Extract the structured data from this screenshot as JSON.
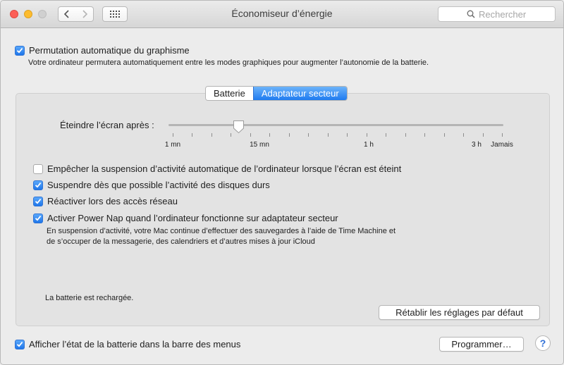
{
  "window": {
    "title": "Économiseur d’énergie",
    "search_placeholder": "Rechercher"
  },
  "graphics_switching": {
    "checked": true,
    "label": "Permutation automatique du graphisme",
    "description": "Votre ordinateur permutera automatiquement entre les modes graphiques pour augmenter l’autonomie de la batterie."
  },
  "tabs": [
    {
      "label": "Batterie",
      "selected": false
    },
    {
      "label": "Adaptateur secteur",
      "selected": true
    }
  ],
  "display_sleep": {
    "label": "Éteindre l’écran après :",
    "selected_value": "10 mn",
    "tick_labels": [
      "1 mn",
      "15 mn",
      "1 h",
      "3 h",
      "Jamais"
    ]
  },
  "options": [
    {
      "checked": false,
      "label": "Empêcher la suspension d’activité automatique de l’ordinateur lorsque l’écran est éteint"
    },
    {
      "checked": true,
      "label": "Suspendre dès que possible l’activité des disques durs"
    },
    {
      "checked": true,
      "label": "Réactiver lors des accès réseau"
    },
    {
      "checked": true,
      "label": "Activer Power Nap quand l’ordinateur fonctionne sur adaptateur secteur"
    }
  ],
  "power_nap_note": {
    "line1": "En suspension d’activité, votre Mac continue d’effectuer des sauvegardes à l’aide de Time Machine et",
    "line2": "de s’occuper de la messagerie, des calendriers et d’autres mises à jour iCloud"
  },
  "battery_status": "La batterie est rechargée.",
  "restore_defaults_label": "Rétablir les réglages par défaut",
  "show_battery_status": {
    "checked": true,
    "label": "Afficher l’état de la batterie dans la barre des menus"
  },
  "schedule_label": "Programmer…",
  "help_label": "?",
  "colors": {
    "accent": "#1f7bf0",
    "close": "#fc5f57",
    "minimize": "#fdbc2e",
    "zoom_disabled": "#d0d0d0"
  },
  "icons": [
    "chevron-left-icon",
    "chevron-right-icon",
    "grid-icon",
    "search-icon",
    "checkmark-icon",
    "slider-thumb-icon",
    "help-icon"
  ]
}
